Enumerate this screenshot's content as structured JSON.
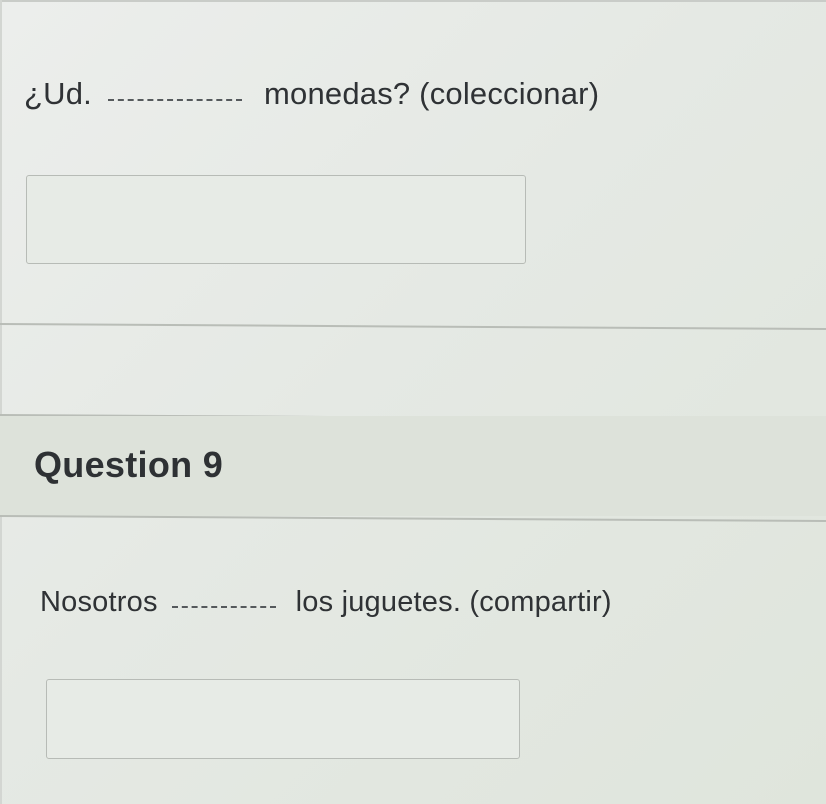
{
  "question_8": {
    "prompt_before": "¿Ud.",
    "prompt_after": "monedas? (coleccionar)",
    "answer_value": ""
  },
  "question_9": {
    "title": "Question 9",
    "prompt_before": "Nosotros",
    "prompt_after": "los juguetes. (compartir)",
    "answer_value": ""
  }
}
